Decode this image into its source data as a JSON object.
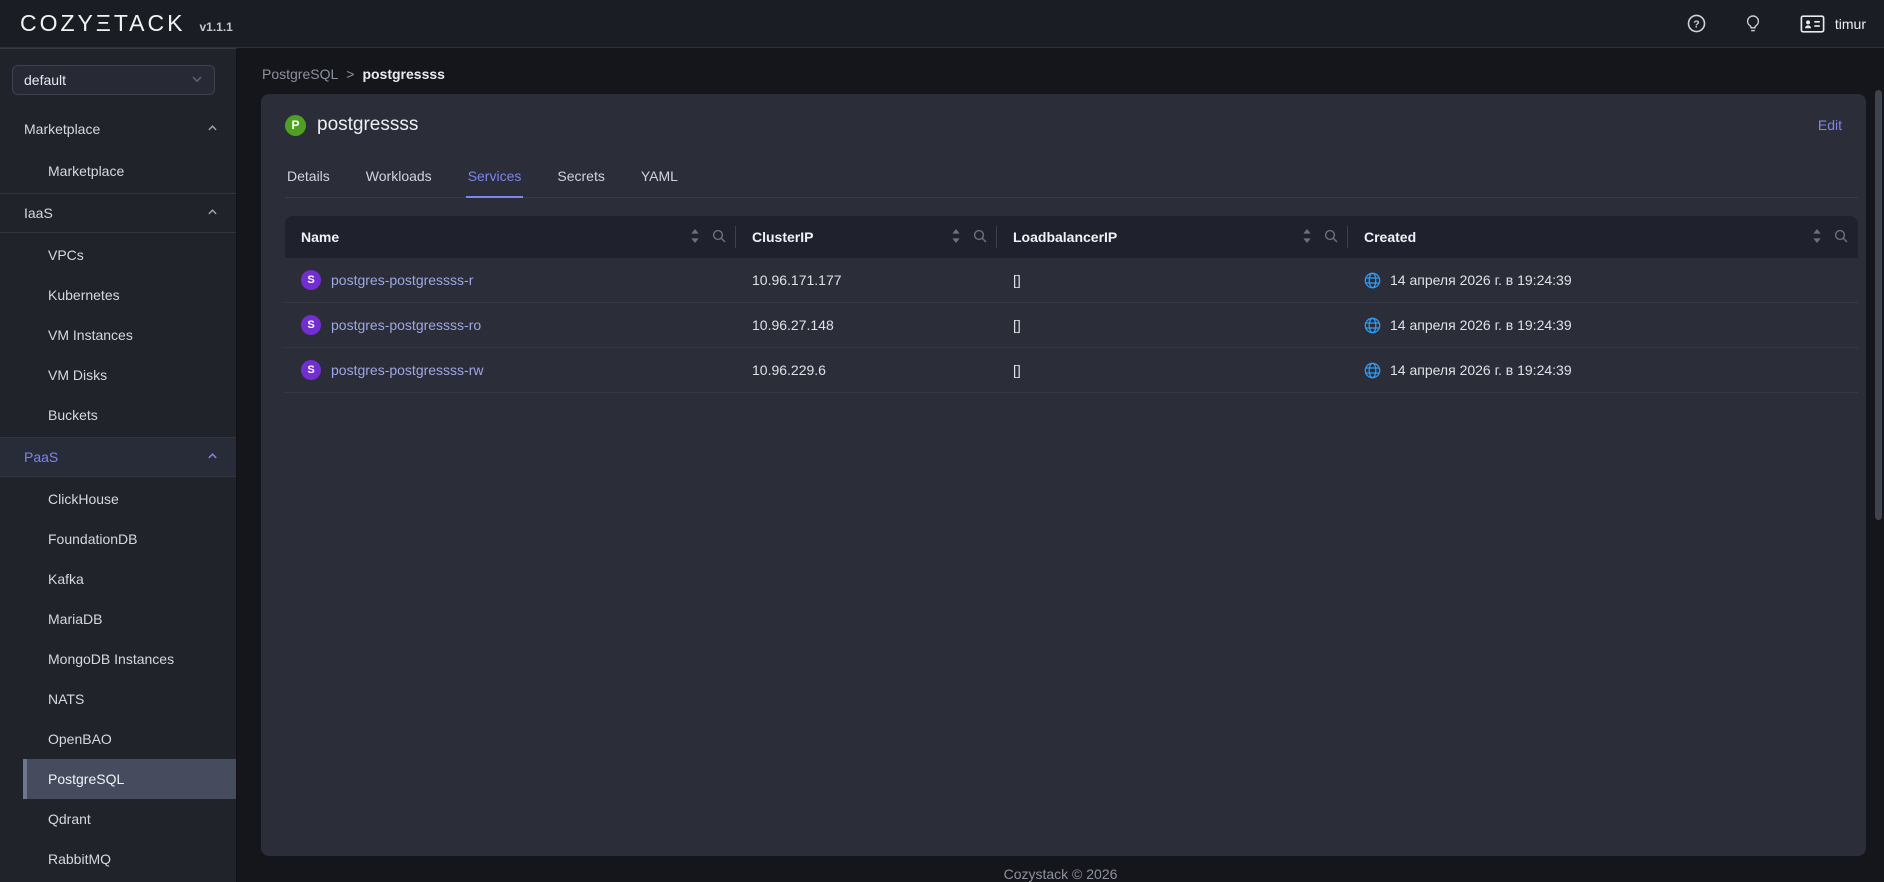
{
  "topbar": {
    "logo": "COZYΞTACK",
    "version": "v1.1.1",
    "user": "timur"
  },
  "sidebar": {
    "project_select": {
      "value": "default"
    },
    "groups": [
      {
        "label": "Marketplace",
        "items": [
          "Marketplace"
        ]
      },
      {
        "label": "IaaS",
        "items": [
          "VPCs",
          "Kubernetes",
          "VM Instances",
          "VM Disks",
          "Buckets"
        ]
      },
      {
        "label": "PaaS",
        "items": [
          "ClickHouse",
          "FoundationDB",
          "Kafka",
          "MariaDB",
          "MongoDB Instances",
          "NATS",
          "OpenBAO",
          "PostgreSQL",
          "Qdrant",
          "RabbitMQ"
        ],
        "selected_item": "PostgreSQL"
      }
    ]
  },
  "breadcrumb": {
    "parent": "PostgreSQL",
    "separator": ">",
    "current": "postgressss"
  },
  "card": {
    "badge_letter": "P",
    "title": "postgressss",
    "edit_label": "Edit"
  },
  "tabs": [
    {
      "label": "Details"
    },
    {
      "label": "Workloads"
    },
    {
      "label": "Services",
      "active": true
    },
    {
      "label": "Secrets"
    },
    {
      "label": "YAML"
    }
  ],
  "table": {
    "columns": [
      {
        "label": "Name"
      },
      {
        "label": "ClusterIP"
      },
      {
        "label": "LoadbalancerIP"
      },
      {
        "label": "Created"
      }
    ],
    "rows": [
      {
        "badge": "S",
        "name": "postgres-postgressss-r",
        "cluster_ip": "10.96.171.177",
        "loadbalancer_ip": "[]",
        "created": "14 апреля 2026 г. в 19:24:39"
      },
      {
        "badge": "S",
        "name": "postgres-postgressss-ro",
        "cluster_ip": "10.96.27.148",
        "loadbalancer_ip": "[]",
        "created": "14 апреля 2026 г. в 19:24:39"
      },
      {
        "badge": "S",
        "name": "postgres-postgressss-rw",
        "cluster_ip": "10.96.229.6",
        "loadbalancer_ip": "[]",
        "created": "14 апреля 2026 г. в 19:24:39"
      }
    ]
  },
  "footer": {
    "copyright": "Cozystack © 2026"
  },
  "colors": {
    "accent": "#7d85ec",
    "service_badge": "#722ed1",
    "app_badge": "#4f9f25",
    "globe": "#2f9bf4",
    "link": "#9fa7e4",
    "card_bg": "#2b2d38",
    "table_header_bg": "#1f222c"
  }
}
